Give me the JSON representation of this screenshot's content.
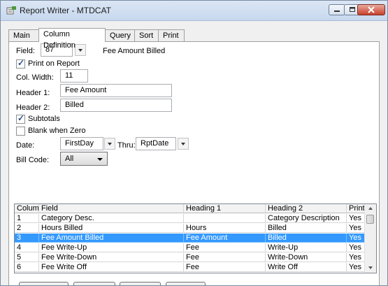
{
  "window": {
    "title": "Report Writer - MTDCAT"
  },
  "tabs": [
    "Main",
    "Column Definition",
    "Query",
    "Sort",
    "Print"
  ],
  "form": {
    "field_label": "Field:",
    "field_value": "87",
    "field_name": "Fee Amount Billed",
    "print_on_report_label": "Print on Report",
    "print_on_report_checked": true,
    "col_width_label": "Col. Width:",
    "col_width_value": "11",
    "header1_label": "Header 1:",
    "header1_value": "Fee Amount",
    "header2_label": "Header 2:",
    "header2_value": "Billed",
    "subtotals_label": "Subtotals",
    "subtotals_checked": true,
    "blank_when_zero_label": "Blank when Zero",
    "blank_when_zero_checked": false,
    "date_label": "Date:",
    "date_from": "FirstDay",
    "thru_label": "Thru:",
    "date_thru": "RptDate",
    "bill_code_label": "Bill Code:",
    "bill_code_value": "All"
  },
  "grid": {
    "columns": [
      "Column",
      "Field",
      "Heading 1",
      "Heading 2",
      "Print"
    ],
    "rows": [
      [
        "1",
        "Category Desc.",
        "",
        "Category Description",
        "Yes"
      ],
      [
        "2",
        "Hours Billed",
        "Hours",
        "Billed",
        "Yes"
      ],
      [
        "3",
        "Fee Amount Billed",
        "Fee Amount",
        "Billed",
        "Yes"
      ],
      [
        "4",
        "Fee Write-Up",
        "Fee",
        "Write-Up",
        "Yes"
      ],
      [
        "5",
        "Fee Write-Down",
        "Fee",
        "Write-Down",
        "Yes"
      ],
      [
        "6",
        "Fee Write Off",
        "Fee",
        "Write Off",
        "Yes"
      ]
    ],
    "selected_row": 3
  },
  "colors": {
    "selection": "#3399ff",
    "titlebar": "#c7d8ee",
    "close_button": "#c8412c"
  }
}
